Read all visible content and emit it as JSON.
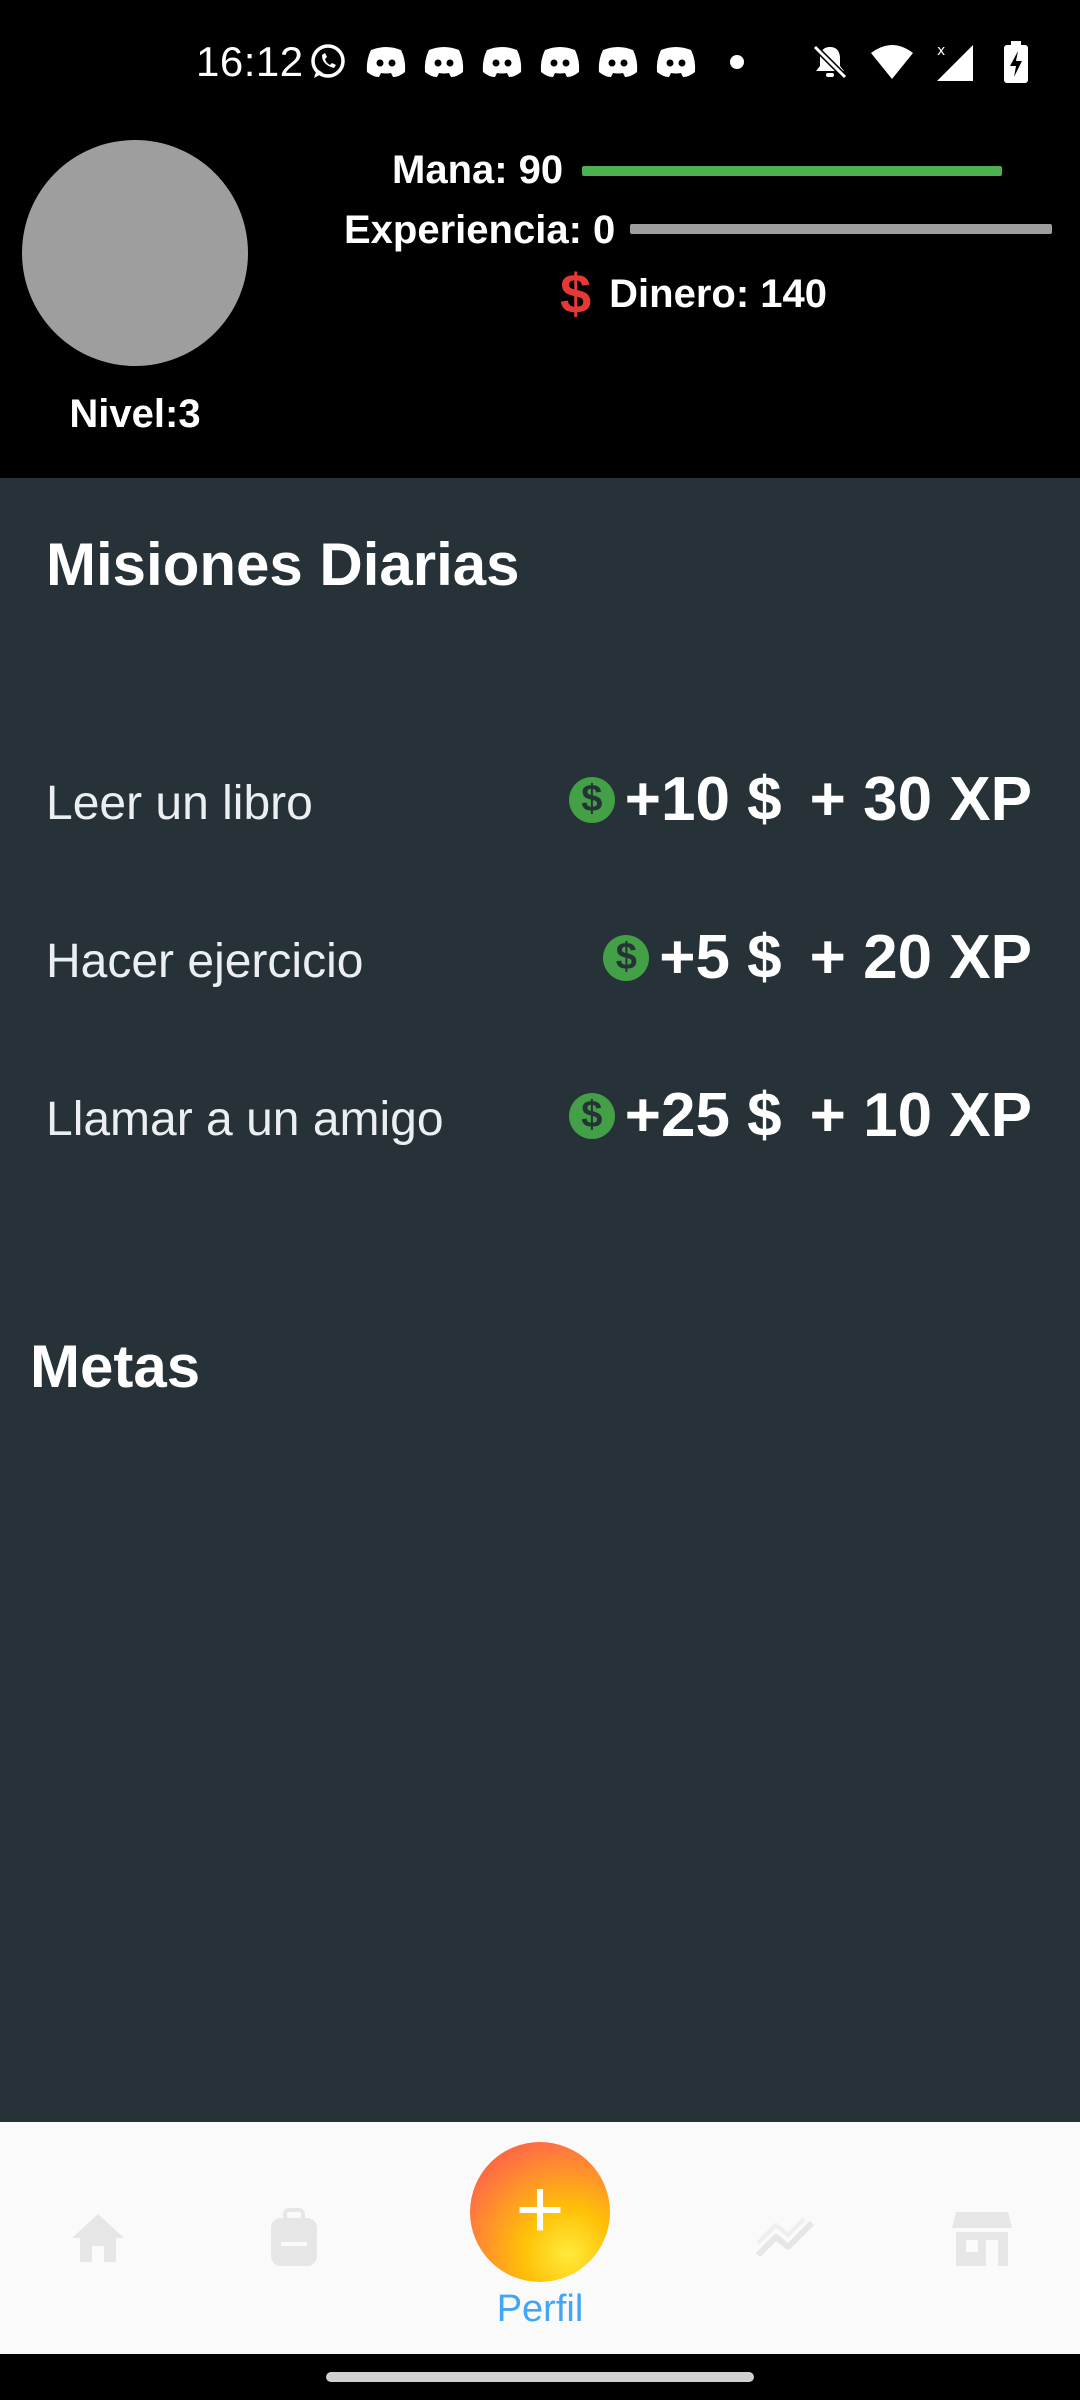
{
  "status_bar": {
    "time": "16:12",
    "left_icons": [
      "whatsapp-icon",
      "discord-icon",
      "discord-icon",
      "discord-icon",
      "discord-icon",
      "discord-icon",
      "discord-icon",
      "more-dot-icon"
    ],
    "right_icons": [
      "notifications-off-icon",
      "wifi-icon",
      "signal-icon",
      "battery-charging-icon"
    ]
  },
  "profile": {
    "mana_label": "Mana: 90",
    "mana_value": 90,
    "experience_label": "Experiencia: 0",
    "experience_value": 0,
    "money_symbol": "$",
    "money_label": "Dinero: 140",
    "level_label": "Nivel:3"
  },
  "daily": {
    "title": "Misiones Diarias",
    "missions": [
      {
        "name": "Leer un libro",
        "coin": "$",
        "money": "+10 $",
        "xp": "+ 30 XP"
      },
      {
        "name": "Hacer ejercicio",
        "coin": "$",
        "money": "+5 $",
        "xp": "+ 20 XP"
      },
      {
        "name": "Llamar a un amigo",
        "coin": "$",
        "money": "+25 $",
        "xp": "+ 10 XP"
      }
    ]
  },
  "goals": {
    "title": "Metas"
  },
  "nav": {
    "fab_symbol": "+",
    "active_label": "Perfil",
    "icons": [
      "home-icon",
      "backpack-icon",
      "stats-icon",
      "store-icon"
    ]
  },
  "colors": {
    "main_bg": "#263238",
    "mana_bar": "#4caf50",
    "xp_bar": "#9e9e9e",
    "money_symbol": "#e53935",
    "coin": "#43a047",
    "nav_active": "#42a5f5"
  }
}
